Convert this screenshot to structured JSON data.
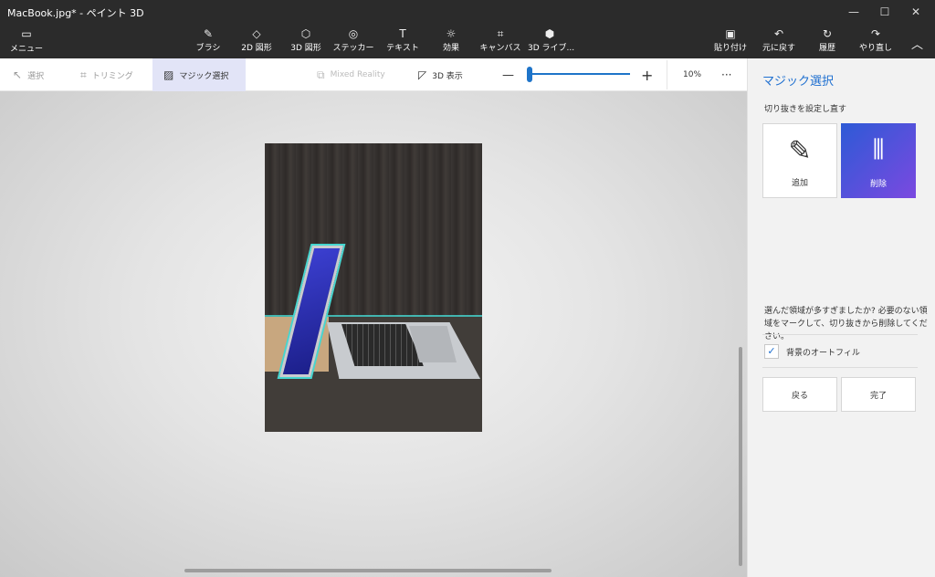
{
  "window": {
    "title": "MacBook.jpg* - ペイント 3D",
    "controls": {
      "minimize": "—",
      "maximize": "☐",
      "close": "✕"
    }
  },
  "menu": {
    "label": "メニュー",
    "icon": "folder-icon"
  },
  "ribbon": {
    "tools": [
      {
        "label": "ブラシ",
        "icon": "brush-icon"
      },
      {
        "label": "2D 図形",
        "icon": "2d-shapes-icon"
      },
      {
        "label": "3D 図形",
        "icon": "3d-shapes-icon"
      },
      {
        "label": "ステッカー",
        "icon": "sticker-icon"
      },
      {
        "label": "テキスト",
        "icon": "text-icon"
      },
      {
        "label": "効果",
        "icon": "effects-icon"
      },
      {
        "label": "キャンバス",
        "icon": "canvas-icon"
      },
      {
        "label": "3D ライブ...",
        "icon": "3d-library-icon"
      }
    ],
    "actions": [
      {
        "label": "貼り付け",
        "icon": "paste-icon"
      },
      {
        "label": "元に戻す",
        "icon": "undo-icon"
      },
      {
        "label": "履歴",
        "icon": "history-icon"
      },
      {
        "label": "やり直し",
        "icon": "redo-icon"
      }
    ]
  },
  "toolbar": {
    "select": "選択",
    "crop": "トリミング",
    "magic_select": "マジック選択",
    "mixed_reality": "Mixed Reality",
    "view_3d": "3D 表示",
    "zoom_minus": "—",
    "zoom_plus": "+",
    "zoom_level": "10%",
    "zoom_fraction": 0.0,
    "more": "···"
  },
  "panel": {
    "title": "マジック選択",
    "subtitle": "切り抜きを設定し直す",
    "add_label": "追加",
    "remove_label": "削除",
    "hint": "選んだ領域が多すぎましたか? 必要のない領域をマークして、切り抜きから削除してください。",
    "autofill_label": "背景のオートフィル",
    "autofill_checked": true,
    "back_label": "戻る",
    "done_label": "完了"
  },
  "colors": {
    "accent": "#1e74c9",
    "topbar": "#2b2b2b",
    "selection_outline": "#46d6d0",
    "active_tool": "#e2e4f7"
  }
}
